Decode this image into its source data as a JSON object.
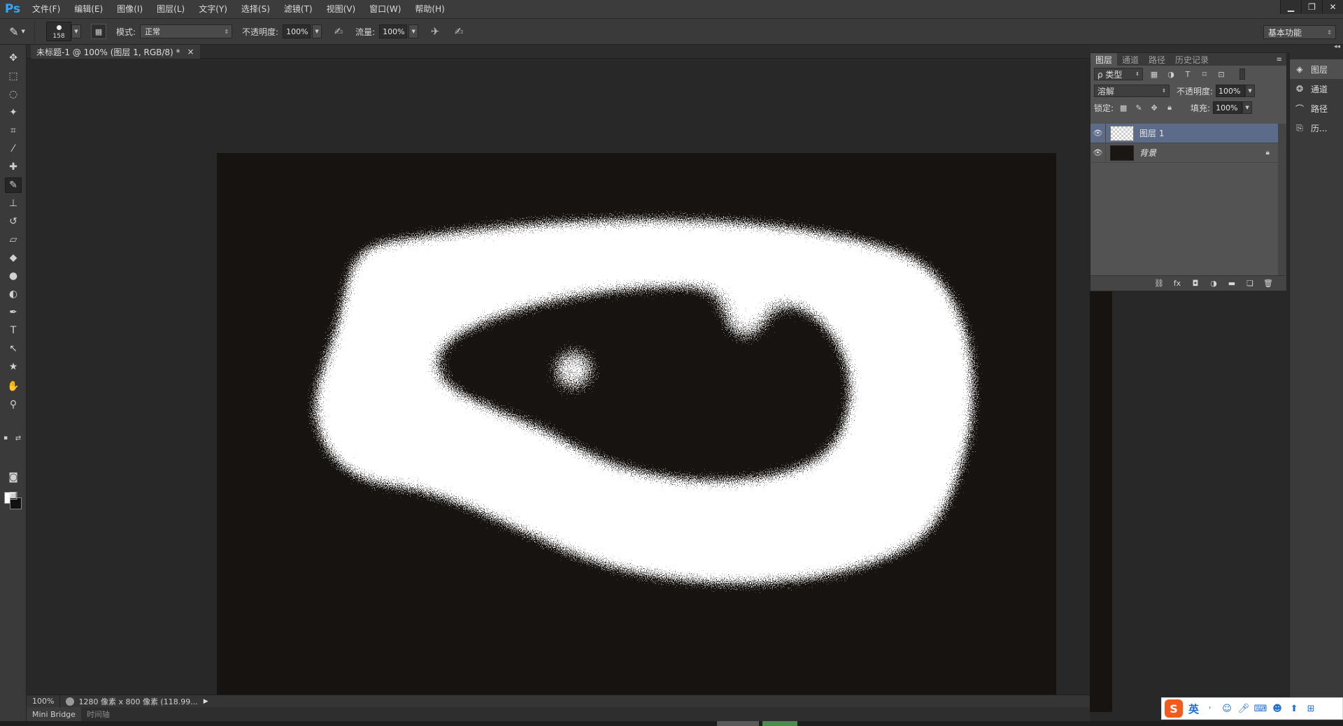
{
  "app": {
    "logo": "Ps",
    "menu": [
      "文件(F)",
      "编辑(E)",
      "图像(I)",
      "图层(L)",
      "文字(Y)",
      "选择(S)",
      "滤镜(T)",
      "视图(V)",
      "窗口(W)",
      "帮助(H)"
    ],
    "window_controls": [
      "minimize-icon",
      "restore-icon",
      "close-icon"
    ]
  },
  "options": {
    "brush_size": "158",
    "mode_label": "模式:",
    "mode_value": "正常",
    "opacity_label": "不透明度:",
    "opacity_value": "100%",
    "flow_label": "流量:",
    "flow_value": "100%",
    "workspace": "基本功能"
  },
  "document": {
    "tab_title": "未标题-1 @ 100% (图层 1, RGB/8) *",
    "close": "×",
    "canvas_bg": "#161311"
  },
  "status": {
    "zoom": "100%",
    "info": "1280 像素 x 800 像素 (118.99..."
  },
  "bottom_tabs": [
    "Mini Bridge",
    "时间轴"
  ],
  "layers_panel": {
    "tabs": [
      "图层",
      "通道",
      "路径",
      "历史记录"
    ],
    "filter_kind": "ρ 类型",
    "blend_mode": "溶解",
    "opacity_label": "不透明度:",
    "opacity_value": "100%",
    "lock_label": "锁定:",
    "fill_label": "填充:",
    "fill_value": "100%",
    "layers": [
      {
        "name": "图层 1",
        "selected": true,
        "visible": true,
        "locked": false
      },
      {
        "name": "背景",
        "selected": false,
        "visible": true,
        "locked": true
      }
    ]
  },
  "dock": {
    "items": [
      "图层",
      "通道",
      "路径",
      "历..."
    ]
  },
  "ime": {
    "logo": "S",
    "lang": "英"
  }
}
